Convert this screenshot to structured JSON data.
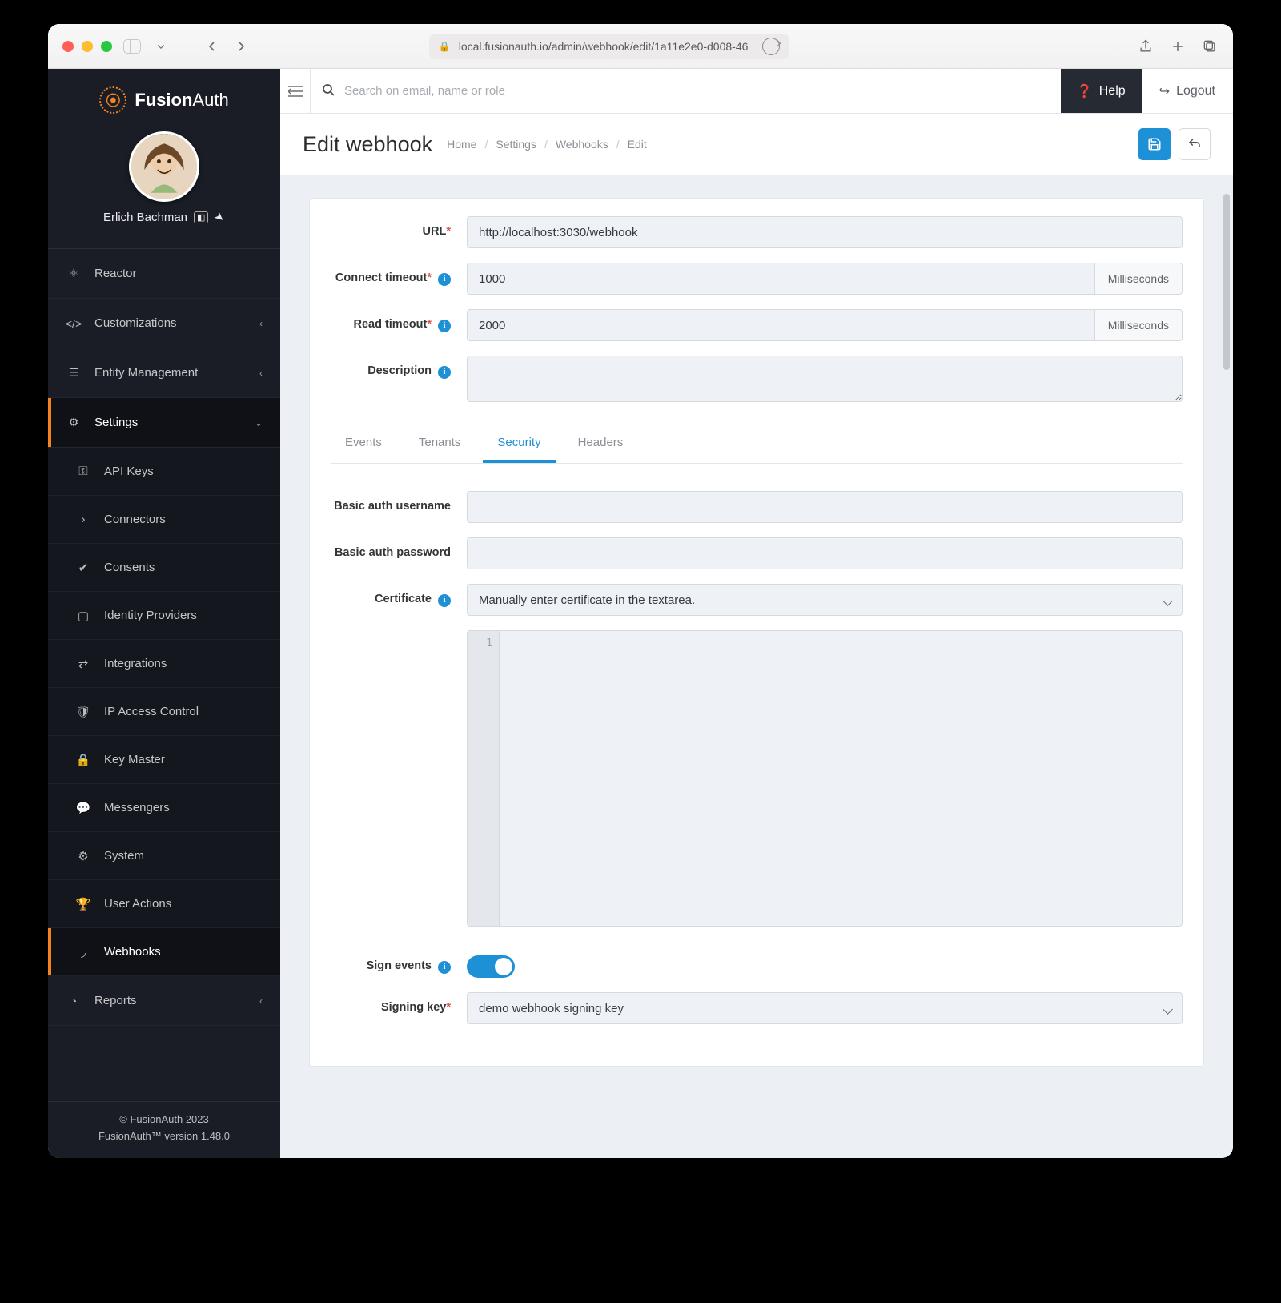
{
  "browser": {
    "url": "local.fusionauth.io/admin/webhook/edit/1a11e2e0-d008-46"
  },
  "brand": {
    "name": "FusionAuth"
  },
  "user": {
    "name": "Erlich Bachman"
  },
  "topbar": {
    "search_placeholder": "Search on email, name or role",
    "help": "Help",
    "logout": "Logout"
  },
  "sidebar": {
    "reactor": "Reactor",
    "customizations": "Customizations",
    "entity": "Entity Management",
    "settings": "Settings",
    "settings_sub": {
      "api": "API Keys",
      "connectors": "Connectors",
      "consents": "Consents",
      "idp": "Identity Providers",
      "integrations": "Integrations",
      "ipac": "IP Access Control",
      "keymaster": "Key Master",
      "messengers": "Messengers",
      "system": "System",
      "useractions": "User Actions",
      "webhooks": "Webhooks"
    },
    "reports": "Reports"
  },
  "footer": {
    "copyright": "© FusionAuth 2023",
    "version": "FusionAuth™ version 1.48.0"
  },
  "page": {
    "title": "Edit webhook",
    "breadcrumbs": [
      "Home",
      "Settings",
      "Webhooks",
      "Edit"
    ]
  },
  "form": {
    "url_label": "URL",
    "url_value": "http://localhost:3030/webhook",
    "connect_label": "Connect timeout",
    "connect_value": "1000",
    "read_label": "Read timeout",
    "read_value": "2000",
    "ms": "Milliseconds",
    "desc_label": "Description",
    "desc_value": ""
  },
  "tabs": {
    "events": "Events",
    "tenants": "Tenants",
    "security": "Security",
    "headers": "Headers"
  },
  "security": {
    "bau_label": "Basic auth username",
    "bau_value": "",
    "bap_label": "Basic auth password",
    "bap_value": "",
    "cert_label": "Certificate",
    "cert_select": "Manually enter certificate in the textarea.",
    "cert_line": "1",
    "sign_label": "Sign events",
    "key_label": "Signing key",
    "key_value": "demo webhook signing key"
  }
}
